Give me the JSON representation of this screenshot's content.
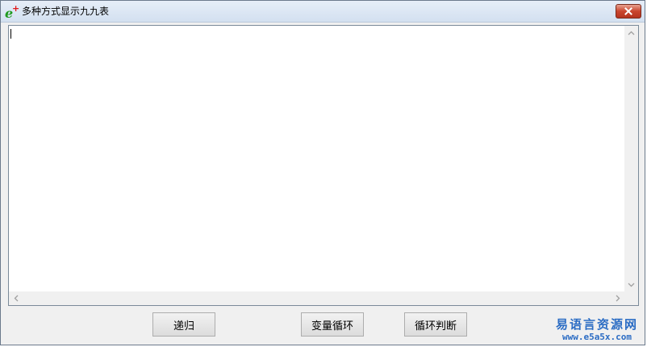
{
  "window": {
    "title": "多种方式显示九九表",
    "app_icon_letter": "e",
    "app_icon_plus": "+"
  },
  "colors": {
    "title_gradient_top": "#e6eef8",
    "close_button": "#c9452e",
    "watermark_blue": "#2b6cc4",
    "icon_green": "#1f9a1f",
    "icon_red": "#e01818"
  },
  "editor": {
    "value": ""
  },
  "buttons": {
    "recursion": "递归",
    "variable_loop": "变量循环",
    "loop_judge": "循环判断"
  },
  "watermark": {
    "line1": "易语言资源网",
    "line2": "www.e5a5x.com"
  },
  "icons": {
    "close": "close-icon",
    "app": "app-icon",
    "scroll_up": "chevron-up-icon",
    "scroll_down": "chevron-down-icon",
    "scroll_left": "chevron-left-icon",
    "scroll_right": "chevron-right-icon"
  }
}
